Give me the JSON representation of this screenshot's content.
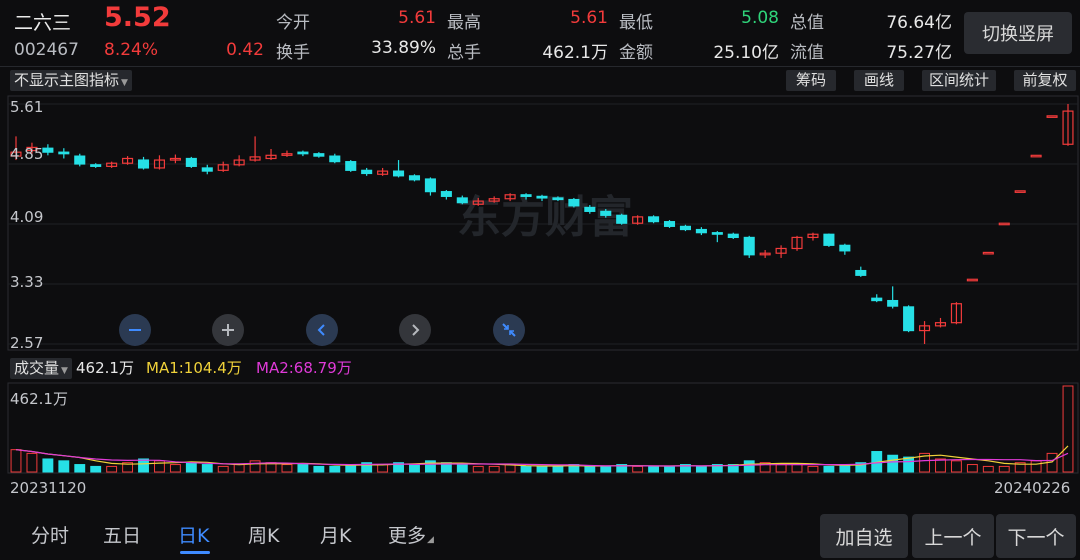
{
  "stock": {
    "name": "二六三",
    "price": "5.52",
    "code": "002467",
    "change_pct": "8.24%",
    "change": "0.42"
  },
  "stats": [
    {
      "label": "今开",
      "value": "5.61",
      "color": "red"
    },
    {
      "label": "最高",
      "value": "5.61",
      "color": "red"
    },
    {
      "label": "最低",
      "value": "5.08",
      "color": "green"
    },
    {
      "label": "总值",
      "value": "76.64亿",
      "color": "white"
    },
    {
      "label": "换手",
      "value": "33.89%",
      "color": "white"
    },
    {
      "label": "总手",
      "value": "462.1万",
      "color": "white"
    },
    {
      "label": "金额",
      "value": "25.10亿",
      "color": "white"
    },
    {
      "label": "流值",
      "value": "75.27亿",
      "color": "white"
    }
  ],
  "switch_label": "切换竖屏",
  "indicator_label": "不显示主图指标",
  "toolbar": [
    "筹码",
    "画线",
    "区间统计",
    "前复权"
  ],
  "y_axis": [
    "5.61",
    "4.85",
    "4.09",
    "3.33",
    "2.57"
  ],
  "watermark": "东方财富",
  "volume": {
    "label": "成交量",
    "value": "462.1万",
    "ma1": "MA1:104.4万",
    "ma2": "MA2:68.79万",
    "axis_max": "462.1万"
  },
  "dates": {
    "start": "20231120",
    "end": "20240226"
  },
  "tabs": [
    "分时",
    "五日",
    "日K",
    "周K",
    "月K",
    "更多"
  ],
  "active_tab": 2,
  "bottom_buttons": [
    "加自选",
    "上一个",
    "下一个"
  ],
  "colors": {
    "up": "#f23b3b",
    "down": "#26e0e6",
    "ma1": "#f0d23a",
    "ma2": "#e03ad8",
    "accent": "#3f8bff"
  },
  "chart_data": {
    "type": "candlestick",
    "y_range": [
      2.57,
      5.61
    ],
    "candles": [
      [
        4.95,
        5.0,
        5.2,
        4.9
      ],
      [
        5.02,
        5.06,
        5.12,
        4.98
      ],
      [
        5.05,
        5.0,
        5.1,
        4.96
      ],
      [
        5.0,
        4.98,
        5.05,
        4.92
      ],
      [
        4.95,
        4.85,
        4.98,
        4.82
      ],
      [
        4.84,
        4.82,
        4.86,
        4.8
      ],
      [
        4.82,
        4.86,
        4.88,
        4.8
      ],
      [
        4.86,
        4.92,
        4.95,
        4.84
      ],
      [
        4.9,
        4.8,
        4.94,
        4.78
      ],
      [
        4.8,
        4.9,
        4.96,
        4.78
      ],
      [
        4.9,
        4.92,
        4.97,
        4.86
      ],
      [
        4.92,
        4.82,
        4.94,
        4.8
      ],
      [
        4.8,
        4.76,
        4.84,
        4.72
      ],
      [
        4.77,
        4.84,
        4.88,
        4.75
      ],
      [
        4.84,
        4.9,
        4.96,
        4.82
      ],
      [
        4.9,
        4.94,
        5.2,
        4.88
      ],
      [
        4.92,
        4.96,
        5.04,
        4.9
      ],
      [
        4.96,
        4.98,
        5.02,
        4.94
      ],
      [
        5.0,
        4.98,
        5.02,
        4.95
      ],
      [
        4.98,
        4.95,
        5.0,
        4.93
      ],
      [
        4.95,
        4.88,
        4.98,
        4.86
      ],
      [
        4.88,
        4.77,
        4.9,
        4.75
      ],
      [
        4.77,
        4.73,
        4.8,
        4.7
      ],
      [
        4.72,
        4.76,
        4.8,
        4.7
      ],
      [
        4.76,
        4.7,
        4.9,
        4.68
      ],
      [
        4.7,
        4.65,
        4.72,
        4.63
      ],
      [
        4.66,
        4.5,
        4.68,
        4.45
      ],
      [
        4.5,
        4.44,
        4.52,
        4.4
      ],
      [
        4.42,
        4.36,
        4.45,
        4.34
      ],
      [
        4.34,
        4.38,
        4.42,
        4.32
      ],
      [
        4.38,
        4.41,
        4.44,
        4.36
      ],
      [
        4.41,
        4.46,
        4.48,
        4.38
      ],
      [
        4.46,
        4.44,
        4.48,
        4.4
      ],
      [
        4.44,
        4.42,
        4.46,
        4.38
      ],
      [
        4.42,
        4.4,
        4.44,
        4.38
      ],
      [
        4.4,
        4.32,
        4.42,
        4.3
      ],
      [
        4.3,
        4.25,
        4.33,
        4.22
      ],
      [
        4.25,
        4.2,
        4.28,
        4.17
      ],
      [
        4.2,
        4.1,
        4.22,
        4.08
      ],
      [
        4.1,
        4.18,
        4.2,
        4.08
      ],
      [
        4.18,
        4.12,
        4.2,
        4.1
      ],
      [
        4.12,
        4.06,
        4.14,
        4.04
      ],
      [
        4.06,
        4.02,
        4.08,
        4.0
      ],
      [
        4.02,
        3.98,
        4.05,
        3.95
      ],
      [
        3.98,
        3.97,
        4.0,
        3.86
      ],
      [
        3.96,
        3.92,
        3.98,
        3.9
      ],
      [
        3.92,
        3.7,
        3.94,
        3.66
      ],
      [
        3.7,
        3.72,
        3.76,
        3.66
      ],
      [
        3.72,
        3.78,
        3.82,
        3.66
      ],
      [
        3.78,
        3.92,
        3.94,
        3.75
      ],
      [
        3.92,
        3.96,
        3.98,
        3.88
      ],
      [
        3.96,
        3.82,
        3.97,
        3.8
      ],
      [
        3.82,
        3.75,
        3.84,
        3.7
      ],
      [
        3.5,
        3.44,
        3.55,
        3.42
      ],
      [
        3.15,
        3.12,
        3.2,
        3.1
      ],
      [
        3.12,
        3.05,
        3.3,
        3.02
      ],
      [
        3.04,
        2.74,
        3.06,
        2.72
      ],
      [
        2.74,
        2.8,
        2.86,
        2.57
      ],
      [
        2.8,
        2.84,
        2.9,
        2.78
      ],
      [
        2.84,
        3.08,
        3.1,
        2.82
      ],
      [
        3.39,
        3.39,
        3.39,
        3.39
      ],
      [
        3.73,
        3.73,
        3.73,
        3.73
      ],
      [
        4.1,
        4.1,
        4.1,
        4.1
      ],
      [
        4.51,
        4.51,
        4.51,
        4.51
      ],
      [
        4.96,
        4.96,
        4.96,
        4.96
      ],
      [
        5.46,
        5.46,
        5.46,
        5.46
      ],
      [
        5.1,
        5.52,
        5.61,
        5.08
      ]
    ],
    "volumes": [
      1.2,
      1.0,
      0.7,
      0.6,
      0.4,
      0.3,
      0.3,
      0.5,
      0.7,
      0.6,
      0.4,
      0.5,
      0.4,
      0.3,
      0.4,
      0.6,
      0.5,
      0.4,
      0.4,
      0.3,
      0.3,
      0.4,
      0.5,
      0.4,
      0.5,
      0.4,
      0.6,
      0.5,
      0.4,
      0.3,
      0.3,
      0.4,
      0.3,
      0.3,
      0.3,
      0.4,
      0.3,
      0.3,
      0.4,
      0.3,
      0.3,
      0.3,
      0.4,
      0.3,
      0.4,
      0.4,
      0.6,
      0.5,
      0.4,
      0.4,
      0.3,
      0.3,
      0.4,
      0.5,
      1.1,
      0.9,
      0.8,
      1.0,
      0.7,
      0.6,
      0.4,
      0.3,
      0.3,
      0.5,
      0.6,
      1.0,
      4.62
    ]
  }
}
